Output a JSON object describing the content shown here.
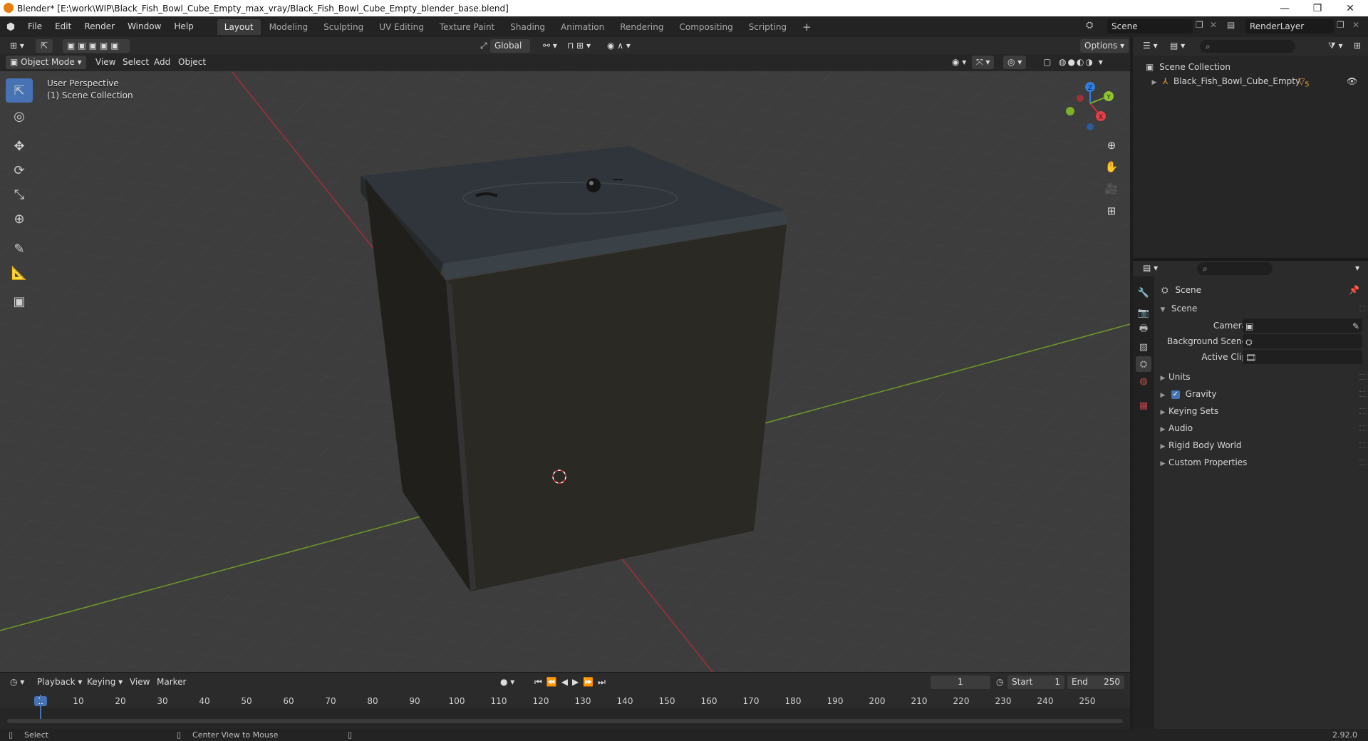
{
  "window": {
    "title": "Blender* [E:\\work\\WIP\\Black_Fish_Bowl_Cube_Empty_max_vray/Black_Fish_Bowl_Cube_Empty_blender_base.blend]",
    "minimize": "—",
    "restore": "❐",
    "close": "✕"
  },
  "menubar": {
    "items": [
      "File",
      "Edit",
      "Render",
      "Window",
      "Help"
    ],
    "workspaces": [
      "Layout",
      "Modeling",
      "Sculpting",
      "UV Editing",
      "Texture Paint",
      "Shading",
      "Animation",
      "Rendering",
      "Compositing",
      "Scripting"
    ],
    "active_workspace": "Layout",
    "add_tab": "+",
    "scene": "Scene",
    "render_layer": "RenderLayer"
  },
  "viewport_header": {
    "orientation": "Global",
    "options": "Options",
    "mode": "Object Mode",
    "menus": [
      "View",
      "Select",
      "Add",
      "Object"
    ]
  },
  "viewport": {
    "perspective": "User Perspective",
    "collection": "(1) Scene Collection",
    "gizmo": {
      "x": "X",
      "y": "Y",
      "z": "Z"
    }
  },
  "timeline": {
    "menus": [
      "Playback",
      "Keying",
      "View",
      "Marker"
    ],
    "current_frame": "1",
    "start_label": "Start",
    "start": "1",
    "end_label": "End",
    "end": "250",
    "ticks": [
      "1",
      "10",
      "20",
      "30",
      "40",
      "50",
      "60",
      "70",
      "80",
      "90",
      "100",
      "110",
      "120",
      "130",
      "140",
      "150",
      "160",
      "170",
      "180",
      "190",
      "200",
      "210",
      "220",
      "230",
      "240",
      "250"
    ]
  },
  "statusbar": {
    "select": "Select",
    "center_view": "Center View to Mouse",
    "version": "2.92.0"
  },
  "outliner": {
    "root": "Scene Collection",
    "items": [
      {
        "name": "Black_Fish_Bowl_Cube_Empty",
        "badge": "5"
      }
    ]
  },
  "properties": {
    "context": "Scene",
    "panel_scene": "Scene",
    "fields": [
      {
        "label": "Camera"
      },
      {
        "label": "Background Scene"
      },
      {
        "label": "Active Clip"
      }
    ],
    "panels": [
      "Units",
      "Gravity",
      "Keying Sets",
      "Audio",
      "Rigid Body World",
      "Custom Properties"
    ],
    "gravity_checked": true
  },
  "colors": {
    "accent": "#4772b3",
    "x_axis": "#c8303a",
    "y_axis": "#7fae2a",
    "z_axis": "#2f7fe0",
    "cube_dark": "#26251f",
    "cube_top": "#2f353a"
  }
}
